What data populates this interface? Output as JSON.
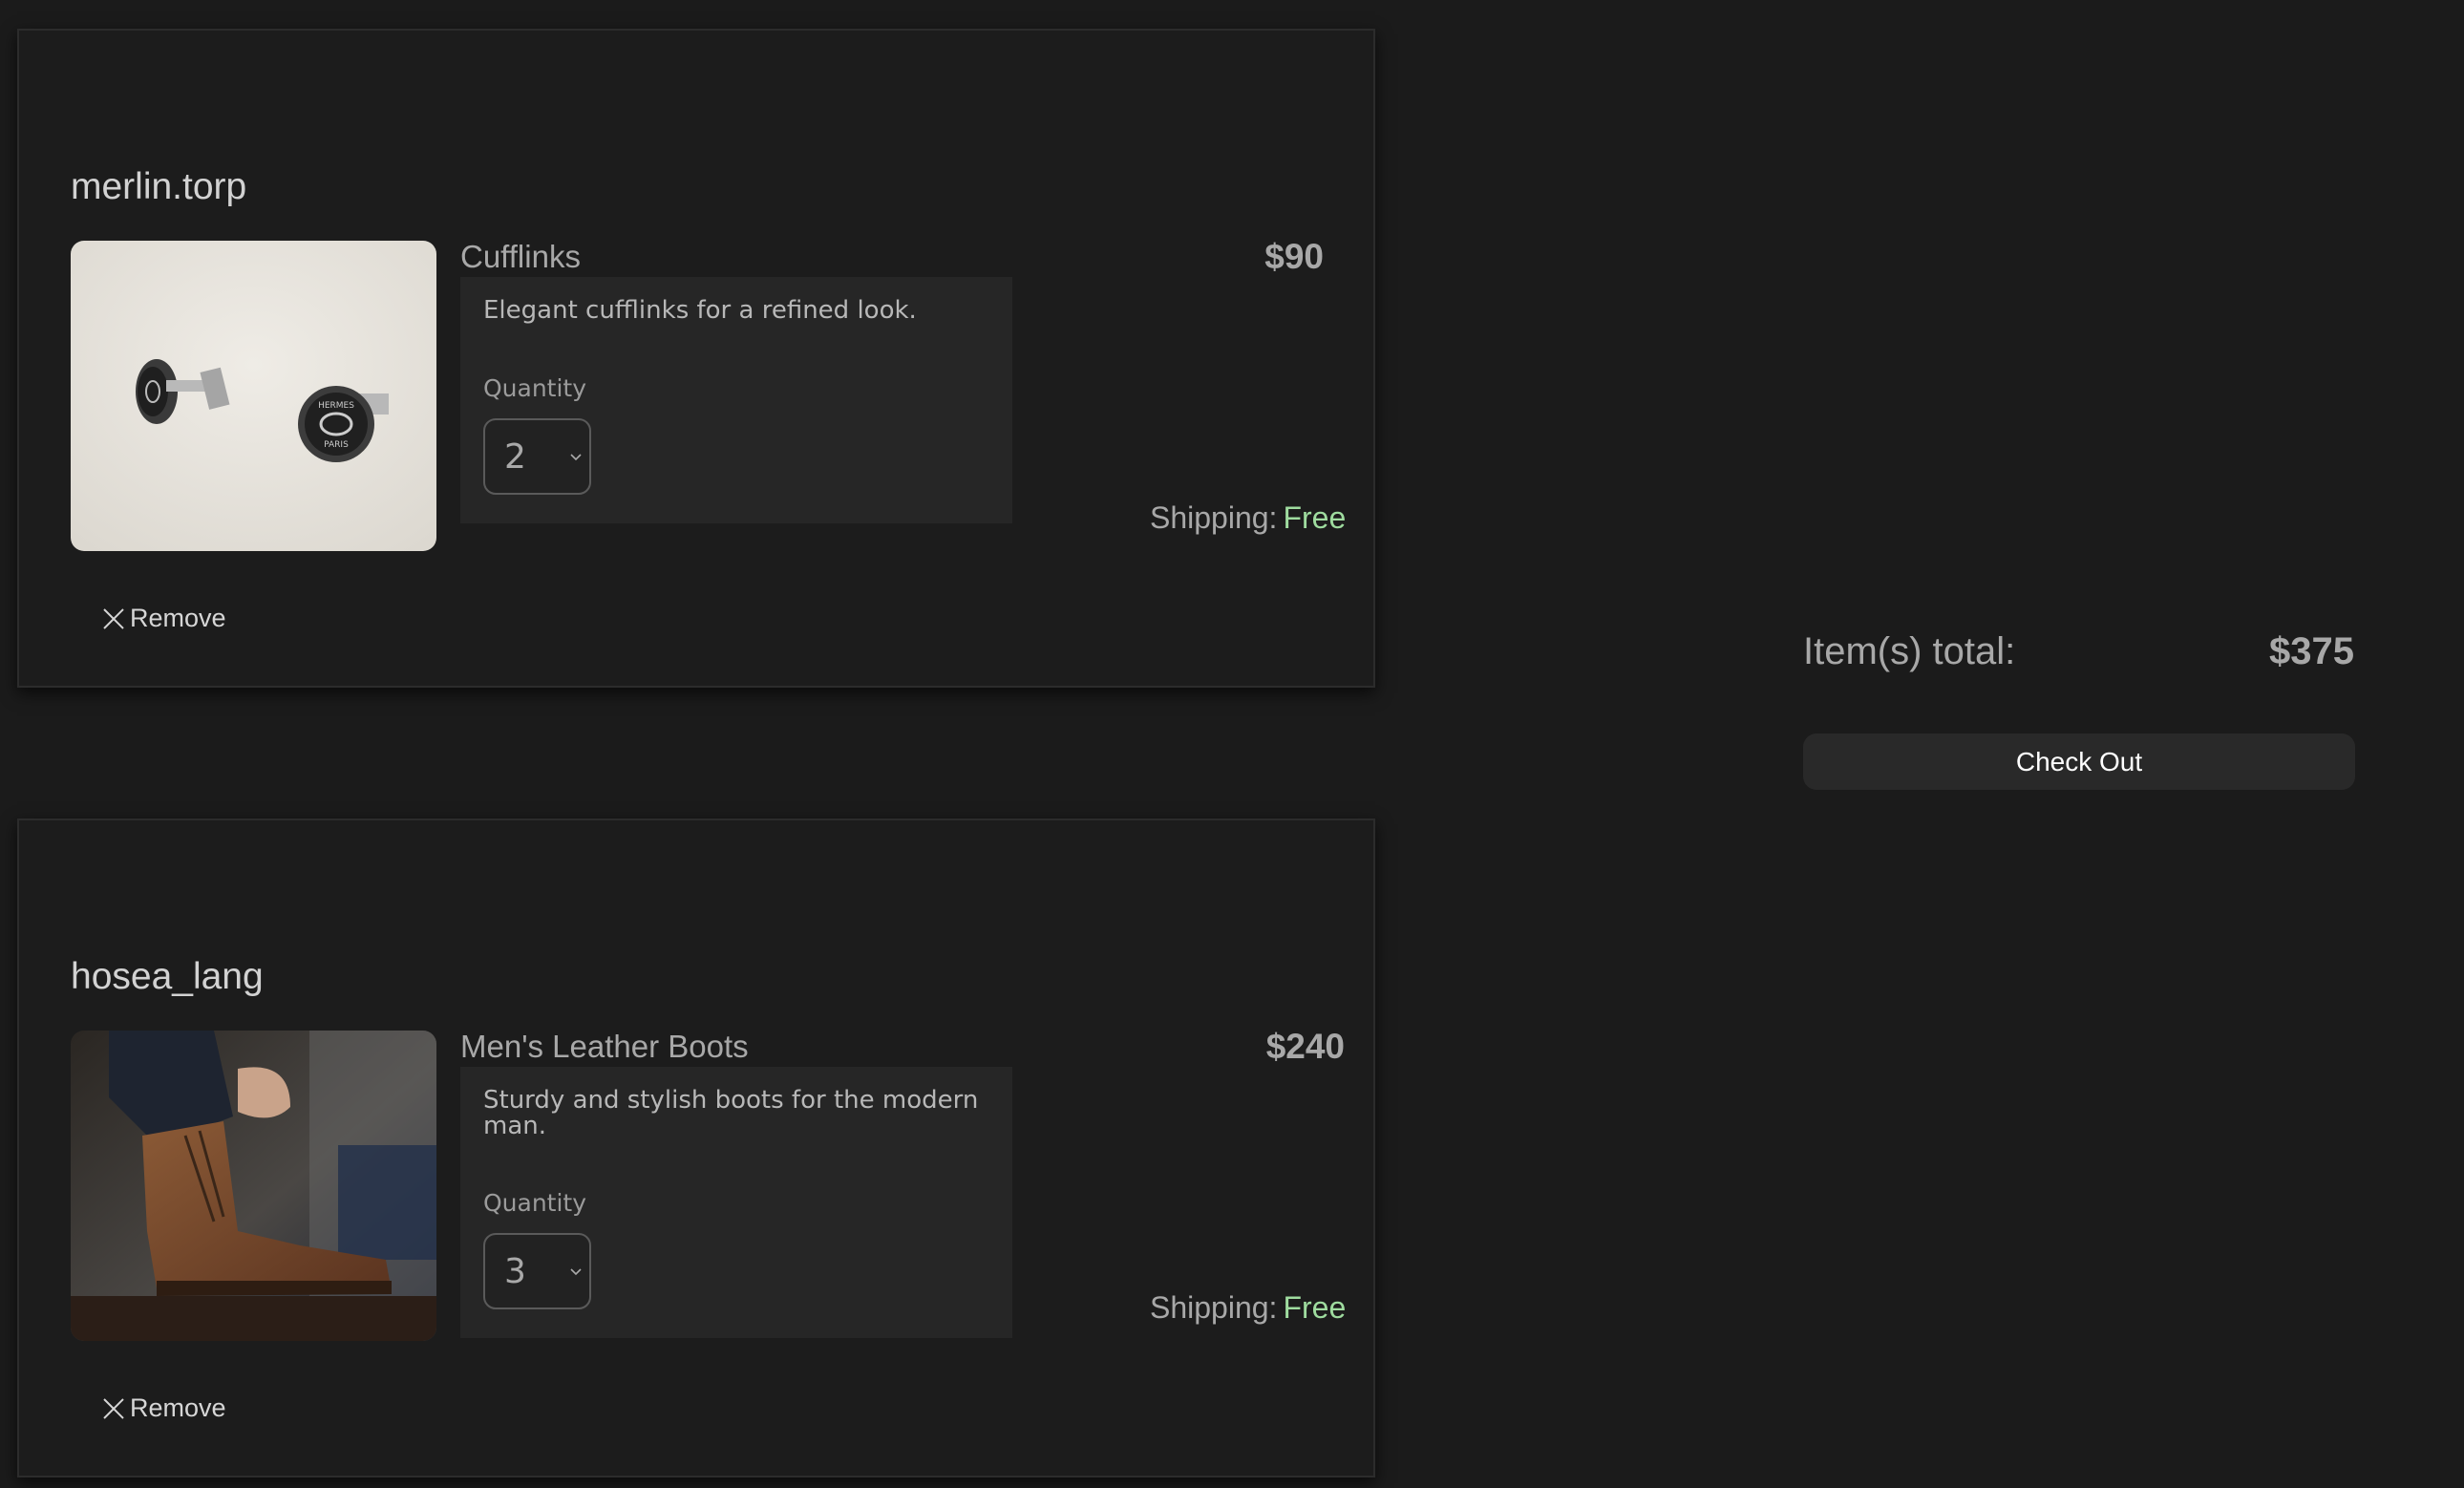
{
  "cart": {
    "items": [
      {
        "seller": "merlin.torp",
        "product_name": "Cufflinks",
        "description": "Elegant cufflinks for a refined look.",
        "quantity_label": "Quantity",
        "quantity": "2",
        "price": "$90",
        "shipping_label": "Shipping:",
        "shipping_value": "Free",
        "remove_label": "Remove",
        "image_icon": "cufflinks-photo"
      },
      {
        "seller": "hosea_lang",
        "product_name": "Men's Leather Boots",
        "description": "Sturdy and stylish boots for the modern man.",
        "quantity_label": "Quantity",
        "quantity": "3",
        "price": "$240",
        "shipping_label": "Shipping:",
        "shipping_value": "Free",
        "remove_label": "Remove",
        "image_icon": "leather-boots-photo"
      }
    ]
  },
  "summary": {
    "total_label": "Item(s) total:",
    "total_value": "$375",
    "checkout_label": "Check Out"
  },
  "colors": {
    "background": "#1b1b1b",
    "card": "#1c1c1c",
    "shipping_free": "#9fdc9f",
    "button": "#292929"
  }
}
